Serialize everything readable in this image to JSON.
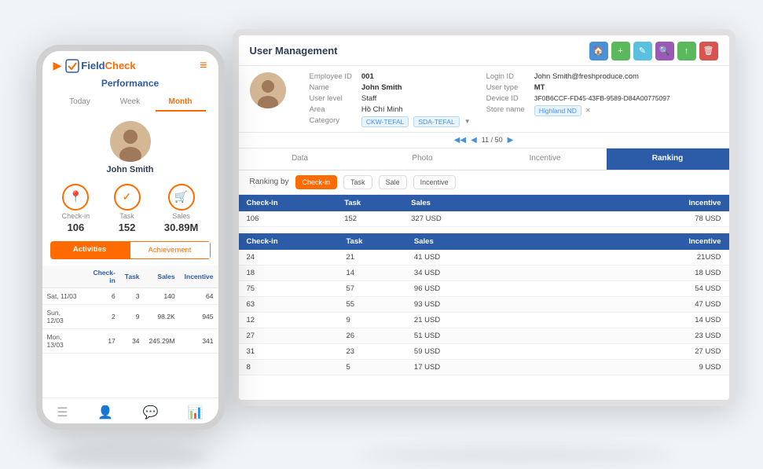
{
  "page": {
    "title": "User Management"
  },
  "toolbar": {
    "buttons": [
      {
        "label": "🏠",
        "color": "#4a90d9",
        "name": "home-button"
      },
      {
        "label": "+",
        "color": "#5cb85c",
        "name": "add-button"
      },
      {
        "label": "✎",
        "color": "#5bc0de",
        "name": "edit-button"
      },
      {
        "label": "🔍",
        "color": "#9b59b6",
        "name": "search-button"
      },
      {
        "label": "↑",
        "color": "#5cb85c",
        "name": "export-button"
      },
      {
        "label": "🗑",
        "color": "#d9534f",
        "name": "delete-button"
      }
    ]
  },
  "user": {
    "employee_id_label": "Employee ID",
    "employee_id_value": "001",
    "name_label": "Name",
    "name_value": "John Smith",
    "user_level_label": "User level",
    "user_level_value": "Staff",
    "area_label": "Area",
    "area_value": "Hồ Chí Minh",
    "category_label": "Category",
    "category_tags": [
      "CKW-TEFAL",
      "SDA-TEFAL"
    ],
    "login_id_label": "Login ID",
    "login_id_value": "John Smith@freshproduce.com",
    "user_type_label": "User type",
    "user_type_value": "MT",
    "device_id_label": "Device ID",
    "device_id_value": "3F0B6CCF-FD45-43FB-9589-D84A00775097",
    "store_name_label": "Store name",
    "store_name_value": "Highland ND"
  },
  "pagination": {
    "text": "11 / 50"
  },
  "tabs": [
    {
      "label": "Data",
      "active": false
    },
    {
      "label": "Photo",
      "active": false
    },
    {
      "label": "Incentive",
      "active": false
    },
    {
      "label": "Ranking",
      "active": true
    }
  ],
  "ranking": {
    "label": "Ranking by",
    "buttons": [
      {
        "label": "Check-in",
        "active": true
      },
      {
        "label": "Task",
        "active": false
      },
      {
        "label": "Sale",
        "active": false
      },
      {
        "label": "Incentive",
        "active": false
      }
    ]
  },
  "table_top": {
    "headers": [
      "Check-in",
      "Task",
      "Sales",
      "",
      "",
      "",
      "",
      "Incentive"
    ],
    "rows": [
      {
        "checkin": "106",
        "task": "152",
        "sales": "327 USD",
        "incentive": "78 USD"
      }
    ]
  },
  "table_main": {
    "headers": [
      "Check-in",
      "Task",
      "Sales",
      "",
      "",
      "",
      "",
      "Incentive"
    ],
    "rows": [
      {
        "checkin": "24",
        "task": "21",
        "sales": "41 USD",
        "incentive": "21USD"
      },
      {
        "checkin": "18",
        "task": "14",
        "sales": "34 USD",
        "incentive": "18 USD"
      },
      {
        "checkin": "75",
        "task": "57",
        "sales": "96 USD",
        "incentive": "54 USD"
      },
      {
        "checkin": "63",
        "task": "55",
        "sales": "93 USD",
        "incentive": "47 USD"
      },
      {
        "checkin": "12",
        "task": "9",
        "sales": "21 USD",
        "incentive": "14 USD"
      },
      {
        "checkin": "27",
        "task": "26",
        "sales": "51 USD",
        "incentive": "23 USD"
      },
      {
        "checkin": "31",
        "task": "23",
        "sales": "59 USD",
        "incentive": "27 USD"
      },
      {
        "checkin": "8",
        "task": "5",
        "sales": "17 USD",
        "incentive": "9 USD"
      }
    ]
  },
  "phone": {
    "logo_field": "Field",
    "logo_check": "Check",
    "section_title": "Performance",
    "period_tabs": [
      {
        "label": "Today",
        "active": false
      },
      {
        "label": "Week",
        "active": false
      },
      {
        "label": "Month",
        "active": true
      }
    ],
    "user_name": "John Smith",
    "stats": [
      {
        "icon": "📍",
        "label": "Check-in",
        "value": "106"
      },
      {
        "icon": "✓",
        "label": "Task",
        "value": "152"
      },
      {
        "icon": "🛒",
        "label": "Sales",
        "value": "30.89M"
      }
    ],
    "activity_tabs": [
      {
        "label": "Activities",
        "active": true
      },
      {
        "label": "Achievement",
        "active": false
      }
    ],
    "table_headers": [
      "",
      "Check-in",
      "Task",
      "Sales",
      "Incentive"
    ],
    "table_rows": [
      {
        "date": "Sat, 11/03",
        "checkin": "6",
        "task": "3",
        "sales": "140",
        "incentive": "64"
      },
      {
        "date": "Sun, 12/03",
        "checkin": "2",
        "task": "9",
        "sales": "98.2K",
        "incentive": "945"
      },
      {
        "date": "Mon, 13/03",
        "checkin": "17",
        "task": "34",
        "sales": "245.29M",
        "incentive": "341"
      }
    ],
    "nav_items": [
      {
        "icon": "☰",
        "label": "menu",
        "active": false
      },
      {
        "icon": "👤",
        "label": "user",
        "active": false
      },
      {
        "icon": "💬",
        "label": "chat",
        "active": false
      },
      {
        "icon": "📊",
        "label": "chart",
        "active": true
      }
    ]
  }
}
